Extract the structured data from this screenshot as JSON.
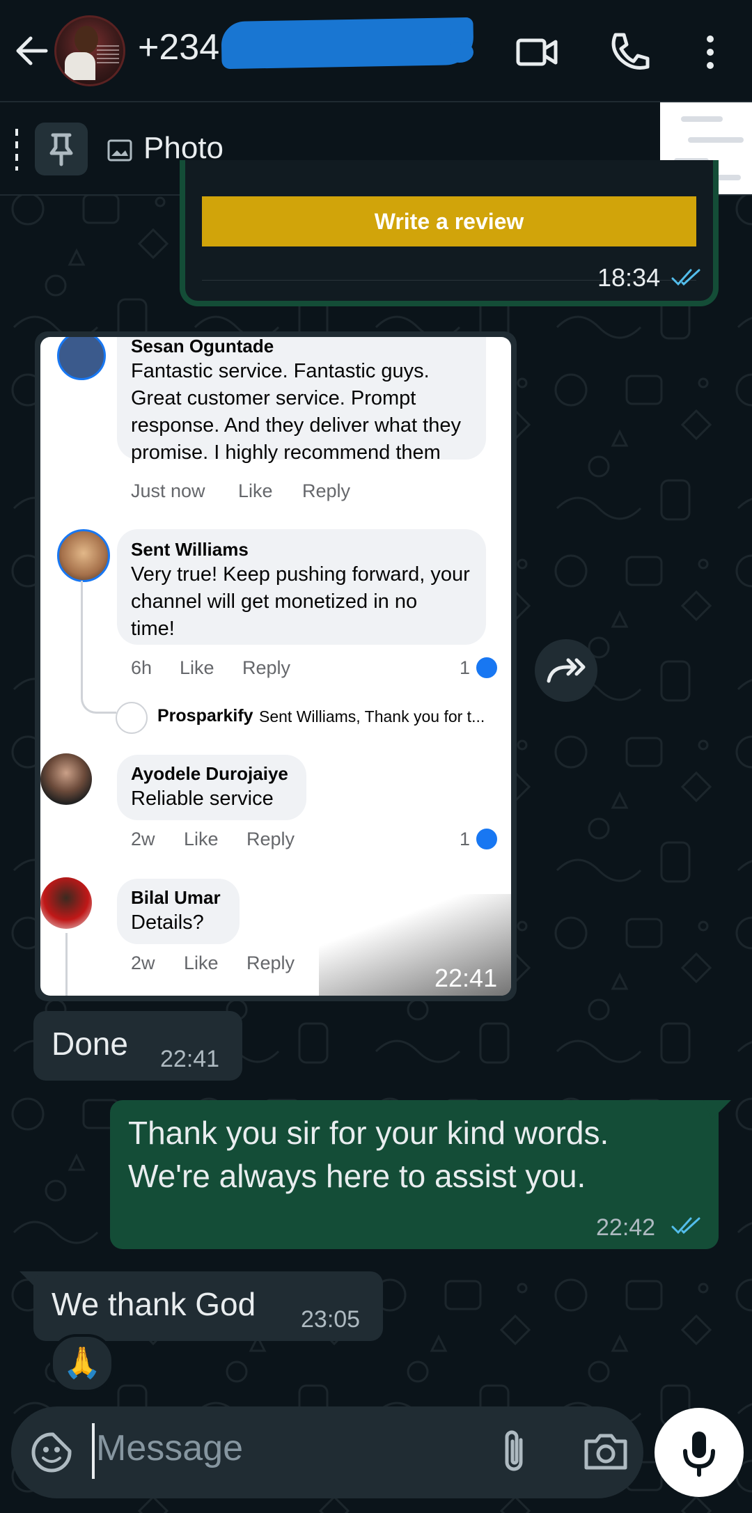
{
  "header": {
    "title": "+234",
    "icons": [
      "back-arrow-icon",
      "video-call-icon",
      "voice-call-icon",
      "more-vert-icon"
    ]
  },
  "pinned": {
    "label": "Photo",
    "icons": [
      "pin-icon",
      "photo-icon"
    ]
  },
  "top_card": {
    "button_label": "Write a review",
    "time": "18:34"
  },
  "image_message": {
    "time": "22:41",
    "comments": [
      {
        "name": "Sesan Oguntade",
        "text_lines": [
          "Fantastic service. Fantastic guys.",
          "Great customer service. Prompt",
          "response. And they deliver what they",
          "promise. I highly recommend them"
        ],
        "age": "Just now",
        "like": "Like",
        "reply": "Reply"
      },
      {
        "name": "Sent Williams",
        "text_lines": [
          "Very true! Keep pushing forward, your",
          "channel will get monetized in no",
          "time!"
        ],
        "age": "6h",
        "like": "Like",
        "reply": "Reply",
        "likes": "1"
      },
      {
        "name": "Prosparkify",
        "text": "Sent Williams, Thank you for t..."
      },
      {
        "name": "Ayodele Durojaiye",
        "text": "Reliable service",
        "age": "2w",
        "like": "Like",
        "reply": "Reply",
        "likes": "1"
      },
      {
        "name": "Bilal Umar",
        "text": "Details?",
        "age": "2w",
        "like": "Like",
        "reply": "Reply"
      }
    ]
  },
  "messages": [
    {
      "text": "Done",
      "time": "22:41",
      "direction": "in"
    },
    {
      "text_lines": [
        "Thank you sir for your kind words.",
        "We're always here to assist you."
      ],
      "time": "22:42",
      "direction": "out"
    },
    {
      "text": "We thank God",
      "time": "23:05",
      "direction": "in",
      "reaction": "🙏"
    }
  ],
  "composer": {
    "placeholder": "Message",
    "icons": [
      "emoji-sticker-icon",
      "attach-icon",
      "camera-icon",
      "mic-icon"
    ]
  },
  "colors": {
    "background": "#0b141a",
    "incoming_bubble": "#202c33",
    "outgoing_bubble": "#144d37",
    "read_ticks": "#53bdeb",
    "review_button": "#d1a40a",
    "redaction": "#1976d2"
  }
}
